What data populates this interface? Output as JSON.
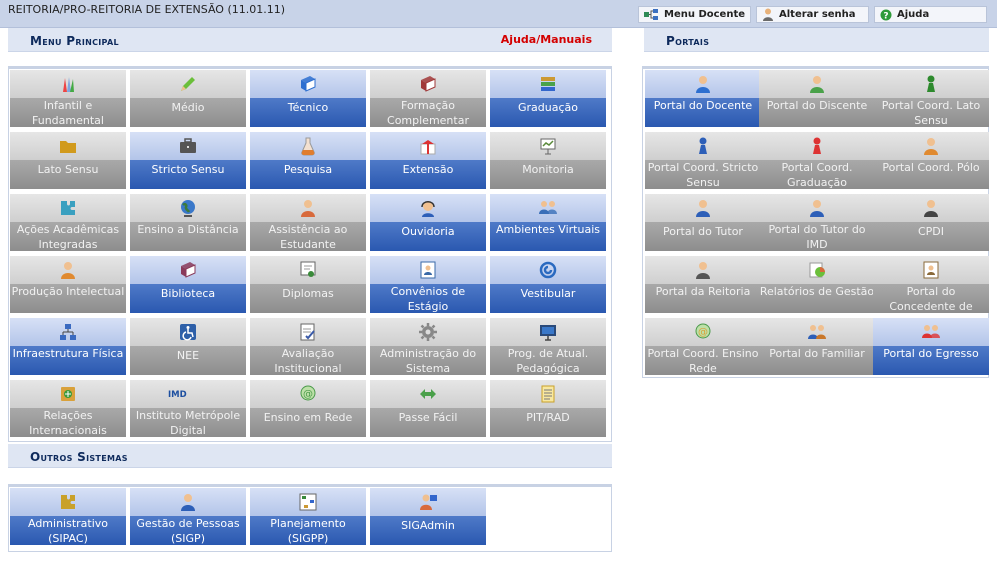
{
  "header": {
    "unit": "REITORIA/PRO-REITORIA DE EXTENSÃO (11.01.11)",
    "actions": [
      {
        "label": "Menu Docente",
        "icon": "menu-docente-icon"
      },
      {
        "label": "Alterar senha",
        "icon": "alterar-senha-icon"
      },
      {
        "label": "Ajuda",
        "icon": "help-icon"
      }
    ]
  },
  "menu": {
    "title": "Menu Principal",
    "help": "Ajuda/Manuais",
    "tiles": [
      [
        "Infantil e Fundamental",
        "gray",
        "#7ea6e0",
        "crayon-icon"
      ],
      [
        "Médio",
        "gray",
        "#6bbf3a",
        "pencil-icon"
      ],
      [
        "Técnico",
        "blue",
        "#2d6fd0",
        "book-icon"
      ],
      [
        "Formação Complementar",
        "gray",
        "#a13838",
        "book-icon"
      ],
      [
        "Graduação",
        "blue",
        "#4aa24a",
        "books-icon"
      ],
      [
        "Lato Sensu",
        "gray",
        "#d19a1c",
        "folder-icon"
      ],
      [
        "Stricto Sensu",
        "blue",
        "#555555",
        "briefcase-icon"
      ],
      [
        "Pesquisa",
        "blue",
        "#e07d2e",
        "flask-icon"
      ],
      [
        "Extensão",
        "blue",
        "#d33",
        "gift-icon"
      ],
      [
        "Monitoria",
        "gray",
        "#5a8a3a",
        "whiteboard-icon"
      ],
      [
        "Ações Acadêmicas Integradas",
        "gray",
        "#3aa0c0",
        "puzzle-icon"
      ],
      [
        "Ensino a Distância",
        "gray",
        "#3c7a3c",
        "globe-icon"
      ],
      [
        "Assistência ao Estudante",
        "gray",
        "#d86a3c",
        "person-icon"
      ],
      [
        "Ouvidoria",
        "blue",
        "#2d5fb8",
        "headset-icon"
      ],
      [
        "Ambientes Virtuais",
        "blue",
        "#3a6fb8",
        "group-icon"
      ],
      [
        "Produção Intelectual",
        "gray",
        "#e08a30",
        "person-icon"
      ],
      [
        "Biblioteca",
        "blue",
        "#8a3a5a",
        "book-icon"
      ],
      [
        "Diplomas",
        "gray",
        "#3a8a3a",
        "certificate-icon"
      ],
      [
        "Convênios de Estágio",
        "blue",
        "#3a6aa8",
        "contact-icon"
      ],
      [
        "Vestibular",
        "blue",
        "#2a6ac0",
        "swirl-icon"
      ],
      [
        "Infraestrutura Física",
        "blue",
        "#3a6ac0",
        "network-icon"
      ],
      [
        "NEE",
        "gray",
        "#2d5fa8",
        "accessibility-icon"
      ],
      [
        "Avaliação Institucional",
        "gray",
        "#3a5aa8",
        "checklist-icon"
      ],
      [
        "Administração do Sistema",
        "gray",
        "#888888",
        "gear-icon"
      ],
      [
        "Prog. de Atual. Pedagógica",
        "gray",
        "#2a4a7a",
        "monitor-icon"
      ],
      [
        "Relações Internacionais",
        "gray",
        "#d9a13a",
        "passport-icon"
      ],
      [
        "Instituto Metrópole Digital",
        "gray",
        "#1d4fa0",
        "imd-logo-icon"
      ],
      [
        "Ensino em Rede",
        "gray",
        "#4a9a4a",
        "at-globe-icon"
      ],
      [
        "Passe Fácil",
        "gray",
        "#4aa04a",
        "arrows-icon"
      ],
      [
        "PIT/RAD",
        "gray",
        "#c9a12a",
        "document-icon"
      ]
    ]
  },
  "outros": {
    "title": "Outros Sistemas",
    "tiles": [
      [
        "Administrativo (SIPAC)",
        "blue",
        "#c9a12a",
        "puzzle-icon"
      ],
      [
        "Gestão de Pessoas (SIGP)",
        "blue",
        "#2d5fb8",
        "person-icon"
      ],
      [
        "Planejamento (SIGPP)",
        "blue",
        "#3a8a3a",
        "diagram-icon"
      ],
      [
        "SIGAdmin",
        "blue",
        "#d86a3c",
        "admin-icon"
      ]
    ]
  },
  "portais": {
    "title": "Portais",
    "tiles": [
      [
        "Portal do Docente",
        "blue",
        "#2d6fd0",
        "person-icon"
      ],
      [
        "Portal do Discente",
        "gray",
        "#4aa24a",
        "person-icon"
      ],
      [
        "Portal Coord. Lato Sensu",
        "gray",
        "#2d8a2d",
        "pawn-icon"
      ],
      [
        "Portal Coord. Stricto Sensu",
        "gray",
        "#2d5fb8",
        "pawn-icon"
      ],
      [
        "Portal Coord. Graduação",
        "gray",
        "#d33",
        "pawn-icon"
      ],
      [
        "Portal Coord. Pólo",
        "gray",
        "#e08a30",
        "person-icon"
      ],
      [
        "Portal do Tutor",
        "gray",
        "#2d5fb8",
        "person-icon"
      ],
      [
        "Portal do Tutor do IMD",
        "gray",
        "#2d5fb8",
        "person-icon"
      ],
      [
        "CPDI",
        "gray",
        "#444444",
        "person-icon"
      ],
      [
        "Portal da Reitoria",
        "gray",
        "#555555",
        "person-icon"
      ],
      [
        "Relatórios de Gestão",
        "gray",
        "#d86a3c",
        "chart-icon"
      ],
      [
        "Portal do Concedente de",
        "gray",
        "#8a6a3a",
        "contact-icon"
      ],
      [
        "Portal Coord. Ensino Rede",
        "gray",
        "#d9a13a",
        "at-globe-icon"
      ],
      [
        "Portal do Familiar",
        "gray",
        "#c9772a",
        "family-icon"
      ],
      [
        "Portal do Egresso",
        "blue",
        "#d33",
        "group-icon"
      ]
    ]
  }
}
